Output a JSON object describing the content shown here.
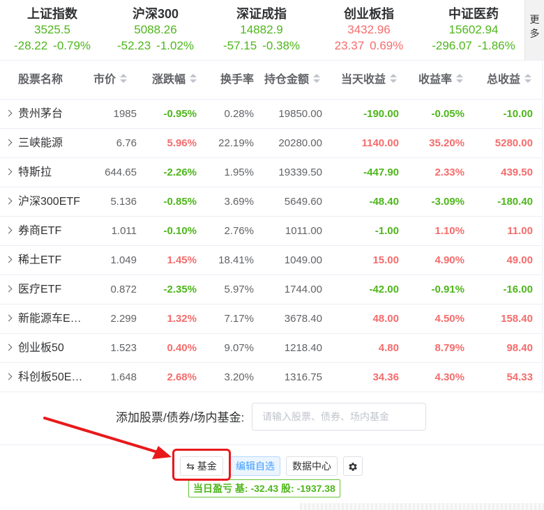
{
  "indices": [
    {
      "name": "上证指数",
      "price": "3525.5",
      "change": "-28.22",
      "percent": "-0.79%",
      "dir": "down"
    },
    {
      "name": "沪深300",
      "price": "5088.26",
      "change": "-52.23",
      "percent": "-1.02%",
      "dir": "down"
    },
    {
      "name": "深证成指",
      "price": "14882.9",
      "change": "-57.15",
      "percent": "-0.38%",
      "dir": "down"
    },
    {
      "name": "创业板指",
      "price": "3432.96",
      "change": "23.37",
      "percent": "0.69%",
      "dir": "up"
    },
    {
      "name": "中证医药",
      "price": "15602.94",
      "change": "-296.07",
      "percent": "-1.86%",
      "dir": "down"
    }
  ],
  "more_label": "更多",
  "table": {
    "headers": {
      "name": "股票名称",
      "price": "市价",
      "change": "涨跌幅",
      "turnover": "换手率",
      "holding": "持仓金额",
      "today": "当天收益",
      "rate": "收益率",
      "total": "总收益"
    },
    "rows": [
      {
        "name": "贵州茅台",
        "price": "1985",
        "change": "-0.95%",
        "turnover": "0.28%",
        "holding": "19850.00",
        "today": "-190.00",
        "rate": "-0.05%",
        "total": "-10.00"
      },
      {
        "name": "三峡能源",
        "price": "6.76",
        "change": "5.96%",
        "turnover": "22.19%",
        "holding": "20280.00",
        "today": "1140.00",
        "rate": "35.20%",
        "total": "5280.00"
      },
      {
        "name": "特斯拉",
        "price": "644.65",
        "change": "-2.26%",
        "turnover": "1.95%",
        "holding": "19339.50",
        "today": "-447.90",
        "rate": "2.33%",
        "total": "439.50"
      },
      {
        "name": "沪深300ETF",
        "price": "5.136",
        "change": "-0.85%",
        "turnover": "3.69%",
        "holding": "5649.60",
        "today": "-48.40",
        "rate": "-3.09%",
        "total": "-180.40"
      },
      {
        "name": "券商ETF",
        "price": "1.011",
        "change": "-0.10%",
        "turnover": "2.76%",
        "holding": "1011.00",
        "today": "-1.00",
        "rate": "1.10%",
        "total": "11.00"
      },
      {
        "name": "稀土ETF",
        "price": "1.049",
        "change": "1.45%",
        "turnover": "18.41%",
        "holding": "1049.00",
        "today": "15.00",
        "rate": "4.90%",
        "total": "49.00"
      },
      {
        "name": "医疗ETF",
        "price": "0.872",
        "change": "-2.35%",
        "turnover": "5.97%",
        "holding": "1744.00",
        "today": "-42.00",
        "rate": "-0.91%",
        "total": "-16.00"
      },
      {
        "name": "新能源车E…",
        "price": "2.299",
        "change": "1.32%",
        "turnover": "7.17%",
        "holding": "3678.40",
        "today": "48.00",
        "rate": "4.50%",
        "total": "158.40"
      },
      {
        "name": "创业板50",
        "price": "1.523",
        "change": "0.40%",
        "turnover": "9.07%",
        "holding": "1218.40",
        "today": "4.80",
        "rate": "8.79%",
        "total": "98.40"
      },
      {
        "name": "科创板50E…",
        "price": "1.648",
        "change": "2.68%",
        "turnover": "3.20%",
        "holding": "1316.75",
        "today": "34.36",
        "rate": "4.30%",
        "total": "54.33"
      }
    ]
  },
  "add": {
    "label": "添加股票/债券/场内基金:",
    "placeholder": "请输入股票、债券、场内基金"
  },
  "toolbar": {
    "fund_label": "⇆ 基金",
    "edit_label": "编辑自选",
    "data_label": "数据中心",
    "gear_icon": "gear-icon"
  },
  "summary": {
    "text": "当日盈亏 基: -32.43   股: -1937.38"
  },
  "colors": {
    "up": "#f56c6c",
    "down": "#4eb61b",
    "annotation": "#e8191a"
  }
}
